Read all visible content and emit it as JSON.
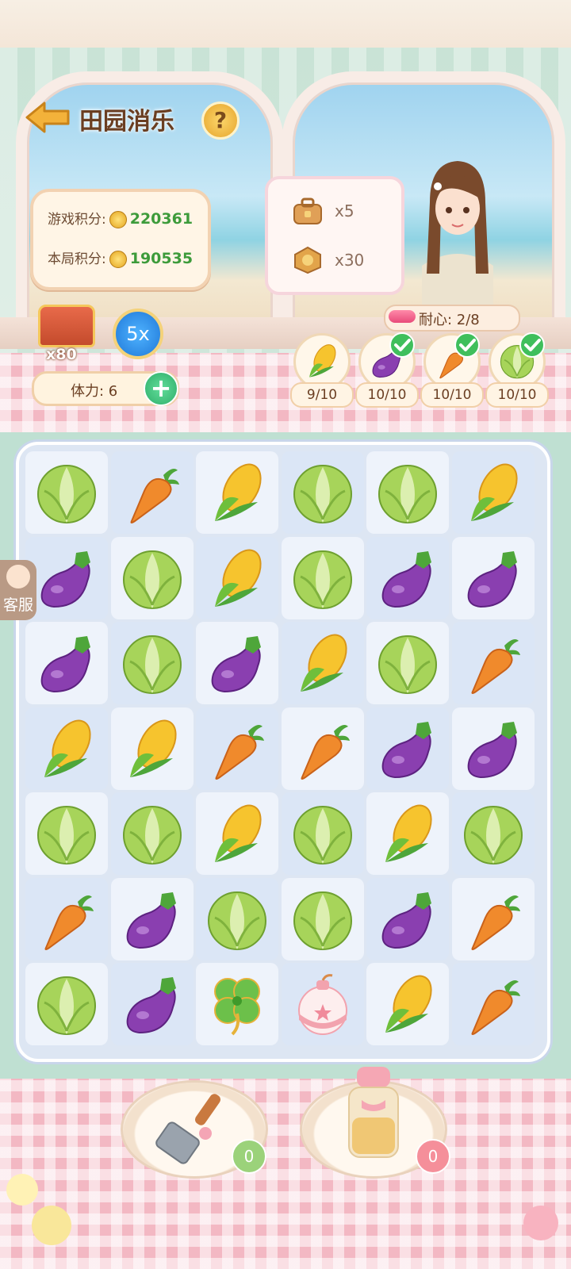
{
  "game": {
    "title": "田园消乐",
    "help_label": "?"
  },
  "scores": {
    "game_label": "游戏积分:",
    "game_value": "220361",
    "round_label": "本局积分:",
    "round_value": "190535"
  },
  "rewards": [
    {
      "icon": "treasure-bag-icon",
      "qty": "x5"
    },
    {
      "icon": "hexagon-token-icon",
      "qty": "x30"
    }
  ],
  "patience": {
    "label": "耐心: 2/8",
    "fraction": 0.25
  },
  "chest": {
    "count": "x80"
  },
  "multiplier": "5x",
  "stamina": {
    "label": "体力: 6",
    "plus": "+"
  },
  "goals": [
    {
      "item": "corn",
      "count": "9/10",
      "done": false
    },
    {
      "item": "eggplant",
      "count": "10/10",
      "done": true
    },
    {
      "item": "carrot",
      "count": "10/10",
      "done": true
    },
    {
      "item": "cabbage",
      "count": "10/10",
      "done": true
    }
  ],
  "service": {
    "label": "客服"
  },
  "board": [
    [
      "cabbage",
      "carrot",
      "corn",
      "cabbage",
      "cabbage",
      "corn"
    ],
    [
      "eggplant",
      "cabbage",
      "corn",
      "cabbage",
      "eggplant",
      "eggplant"
    ],
    [
      "eggplant",
      "cabbage",
      "eggplant",
      "corn",
      "cabbage",
      "carrot"
    ],
    [
      "corn",
      "corn",
      "carrot",
      "carrot",
      "eggplant",
      "eggplant"
    ],
    [
      "cabbage",
      "cabbage",
      "corn",
      "cabbage",
      "corn",
      "cabbage"
    ],
    [
      "carrot",
      "eggplant",
      "cabbage",
      "cabbage",
      "eggplant",
      "carrot"
    ],
    [
      "cabbage",
      "eggplant",
      "clover",
      "bomb",
      "corn",
      "carrot"
    ]
  ],
  "tools": [
    {
      "name": "spatula-tool",
      "count": "0"
    },
    {
      "name": "salt-shaker-tool",
      "count": "0"
    }
  ],
  "colors": {
    "score_green": "#3d9b3a",
    "title_brown": "#6a3e22",
    "tablecloth_pink": "#f3b8c3"
  }
}
